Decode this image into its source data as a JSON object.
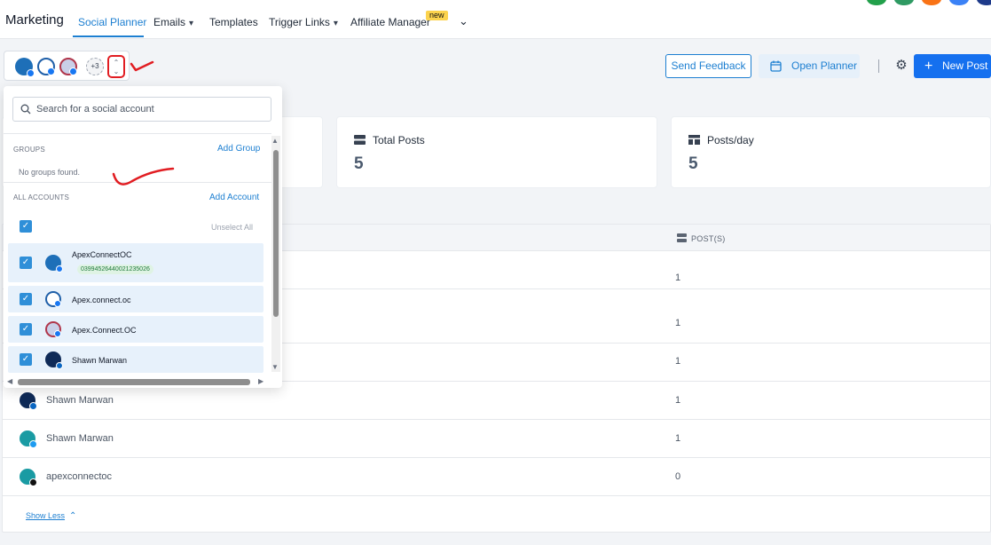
{
  "nav": {
    "brand": "Marketing",
    "tabs": [
      {
        "label": "Social Planner"
      },
      {
        "label": "Emails"
      },
      {
        "label": "Templates"
      },
      {
        "label": "Trigger Links"
      },
      {
        "label": "Affiliate Manager"
      }
    ],
    "new_badge": "new",
    "more_chevron": "⌄"
  },
  "picker": {
    "more_count": "+3",
    "toggle_glyph": "⌃⌄"
  },
  "actions": {
    "send_feedback": "Send Feedback",
    "open_planner": "Open Planner",
    "new_post": "New Post"
  },
  "stats": [
    {
      "label": "Total Posts",
      "value": "5"
    },
    {
      "label": "Posts/day",
      "value": "5"
    }
  ],
  "table": {
    "col_posts": "POST(S)",
    "rows": [
      {
        "name": "",
        "count": "1"
      },
      {
        "name": "",
        "count": "1"
      },
      {
        "name": "",
        "count": "1"
      },
      {
        "name": "Shawn Marwan",
        "count": "1"
      },
      {
        "name": "Shawn Marwan",
        "count": "1"
      },
      {
        "name": "apexconnectoc",
        "count": "0"
      }
    ],
    "show_less": "Show Less"
  },
  "dropdown": {
    "search_placeholder": "Search for a social account",
    "groups_heading": "GROUPS",
    "add_group": "Add Group",
    "no_groups": "No groups found.",
    "accounts_heading": "ALL ACCOUNTS",
    "add_account": "Add Account",
    "unselect_all": "Unselect All",
    "accounts": [
      {
        "name": "ApexConnectOC",
        "id": "03994526440021235026"
      },
      {
        "name": "Apex.connect.oc"
      },
      {
        "name": "Apex.Connect.OC"
      },
      {
        "name": "Shawn Marwan"
      }
    ]
  },
  "colors": {
    "accent": "#1d7fd1",
    "primary": "#1570ef",
    "annotation": "#e11d22"
  }
}
